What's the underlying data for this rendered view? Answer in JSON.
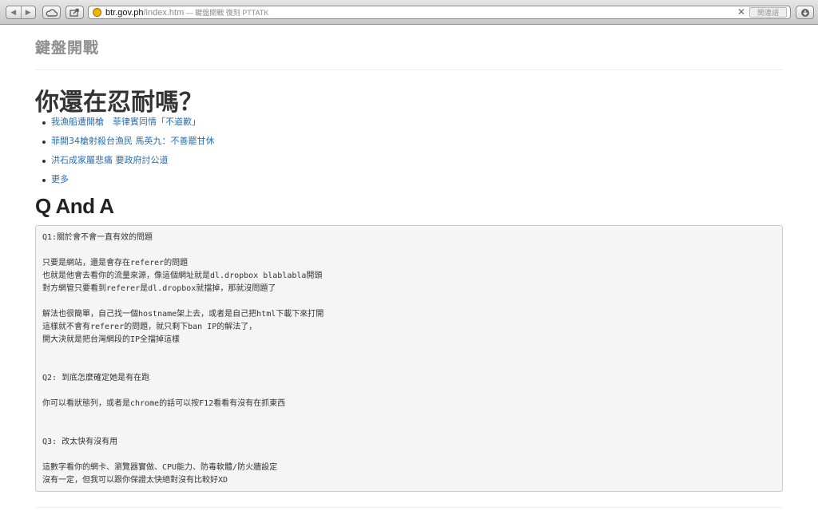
{
  "browser": {
    "back_icon": "◀",
    "forward_icon": "▶",
    "url_domain": "btr.gov.ph",
    "url_path": "/index.htm",
    "page_title_suffix": " — 鍵盤開戰 復刻 PTTATK",
    "search_placeholder": "関連語",
    "clear_icon": "✕"
  },
  "page": {
    "brand": "鍵盤開戰",
    "heading": "你還在忍耐嗎？",
    "news_links": [
      "我漁船遭開槍　菲律賓同情「不道歉」",
      "菲開34槍射殺台漁民 馬英九：不善罷甘休",
      "洪石成家屬悲痛 要政府討公道",
      "更多"
    ],
    "qa_heading": "Q And A",
    "qa_lines": [
      "Q1:關於會不會一直有效的問題",
      "只要是網站，還是會存在referer的問題",
      "也就是他會去看你的流量來源，像這個網址就是dl.dropbox blablabla開頭",
      "對方網管只要看到referer是dl.dropbox就擋掉，那就沒問題了",
      "解法也很簡單，自己找一個hostname架上去，或者是自己把html下載下來打開",
      "這樣就不會有referer的問題，就只剩下ban IP的解法了，",
      "開大決就是把台灣網段的IP全擋掉這樣",
      "Q2: 到底怎麼確定她是有在跑",
      "你可以看狀態列，或者是chrome的話可以按F12看看有沒有在抓東西",
      "Q3: 改太快有沒有用",
      "這數字看你的網卡、瀏覽器實做、CPU能力、防毒軟體/防火牆設定",
      "沒有一定，但我可以跟你保證太快絕對沒有比較好XD"
    ]
  }
}
